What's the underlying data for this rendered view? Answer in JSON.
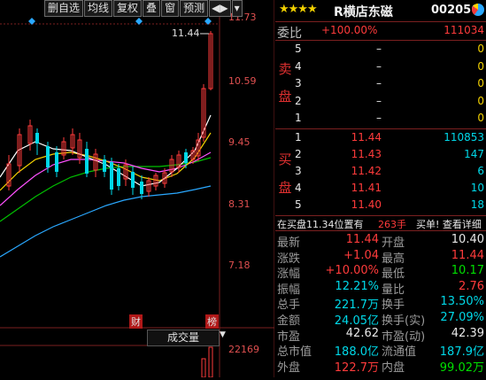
{
  "toolbar": {
    "buttons": [
      "删自选",
      "均线",
      "复权",
      "叠",
      "窗",
      "预测"
    ],
    "icon_buttons": [
      "play-icon",
      "dropdown-icon"
    ]
  },
  "chart": {
    "price_labels": [
      "11.73",
      "10.59",
      "9.45",
      "8.31",
      "7.18"
    ],
    "high_marker": "11.44",
    "event_markers": [
      "财",
      "榜"
    ],
    "volume_label": "成交量",
    "volume_axis": "22169"
  },
  "header": {
    "stars": "★★★★",
    "name": "R横店东磁",
    "code": "002056"
  },
  "ratio": {
    "label": "委比",
    "value": "+100.00%",
    "diff": "111034"
  },
  "sell_side_label": [
    "卖",
    "盘"
  ],
  "buy_side_label": [
    "买",
    "盘"
  ],
  "sell_orders": [
    {
      "level": "5",
      "price": "–",
      "volume": "0"
    },
    {
      "level": "4",
      "price": "–",
      "volume": "0"
    },
    {
      "level": "3",
      "price": "–",
      "volume": "0"
    },
    {
      "level": "2",
      "price": "–",
      "volume": "0"
    },
    {
      "level": "1",
      "price": "–",
      "volume": "0"
    }
  ],
  "buy_orders": [
    {
      "level": "1",
      "price": "11.44",
      "volume": "110853"
    },
    {
      "level": "2",
      "price": "11.43",
      "volume": "147"
    },
    {
      "level": "3",
      "price": "11.42",
      "volume": "6"
    },
    {
      "level": "4",
      "price": "11.41",
      "volume": "10"
    },
    {
      "level": "5",
      "price": "11.40",
      "volume": "18"
    }
  ],
  "status_bar": {
    "text": "在买盘11.34位置有",
    "count": "263手",
    "link": "买单! 查看详细"
  },
  "stats": [
    {
      "l1": "最新",
      "v1": "11.44",
      "c1": "red",
      "l2": "开盘",
      "v2": "10.40",
      "c2": "white"
    },
    {
      "l1": "涨跌",
      "v1": "+1.04",
      "c1": "red",
      "l2": "最高",
      "v2": "11.44",
      "c2": "red"
    },
    {
      "l1": "涨幅",
      "v1": "+10.00%",
      "c1": "red",
      "l2": "最低",
      "v2": "10.17",
      "c2": "green"
    },
    {
      "l1": "振幅",
      "v1": "12.21%",
      "c1": "cyan",
      "l2": "量比",
      "v2": "2.76",
      "c2": "red"
    },
    {
      "l1": "总手",
      "v1": "221.7万",
      "c1": "cyan",
      "l2": "换手",
      "v2": "13.50%",
      "c2": "cyan"
    },
    {
      "l1": "金额",
      "v1": "24.05亿",
      "c1": "cyan",
      "l2": "换手(实)",
      "v2": "27.09%",
      "c2": "cyan"
    },
    {
      "l1": "市盈",
      "v1": "42.62",
      "c1": "white",
      "l2": "市盈(动)",
      "v2": "42.39",
      "c2": "white"
    },
    {
      "l1": "总市值",
      "v1": "188.0亿",
      "c1": "cyan",
      "l2": "流通值",
      "v2": "187.9亿",
      "c2": "cyan"
    },
    {
      "l1": "外盘",
      "v1": "122.7万",
      "c1": "red",
      "l2": "内盘",
      "v2": "99.02万",
      "c2": "green"
    }
  ],
  "colors": {
    "up": "#ff3b3b",
    "down": "#00e000",
    "accent": "#00d8e8",
    "grid": "#7a2020"
  }
}
